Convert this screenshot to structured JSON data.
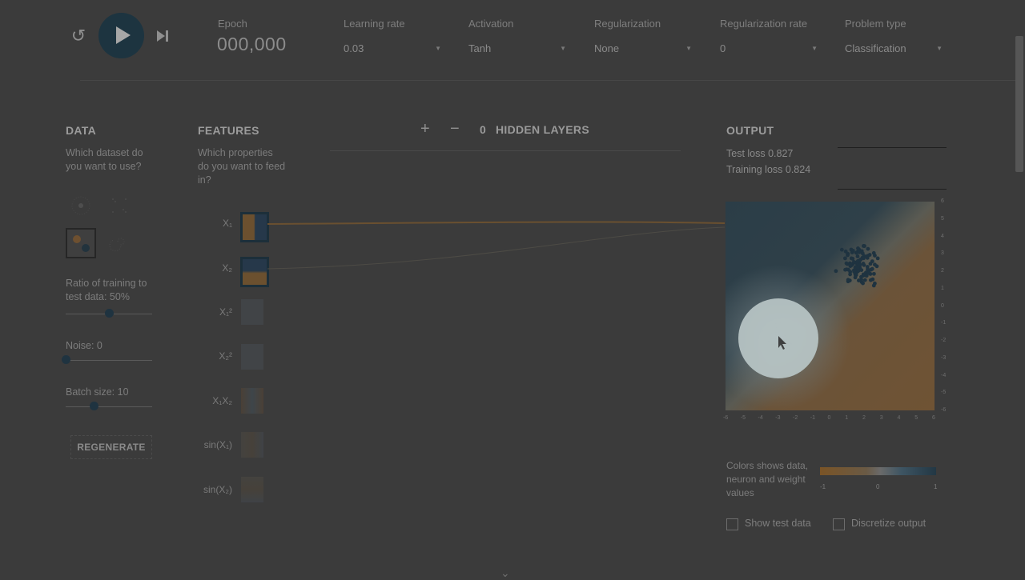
{
  "top_bar": {
    "epoch": {
      "label": "Epoch",
      "value": "000,000"
    },
    "learning_rate": {
      "label": "Learning rate",
      "value": "0.03"
    },
    "activation": {
      "label": "Activation",
      "value": "Tanh"
    },
    "regularization": {
      "label": "Regularization",
      "value": "None"
    },
    "regularization_rate": {
      "label": "Regularization rate",
      "value": "0"
    },
    "problem_type": {
      "label": "Problem type",
      "value": "Classification"
    }
  },
  "data": {
    "title": "DATA",
    "question": "Which dataset do you want to use?",
    "ratio_label": "Ratio of training to test data:",
    "ratio_value": "50%",
    "ratio_fraction": 0.5,
    "noise_label": "Noise:",
    "noise_value": "0",
    "noise_fraction": 0.0,
    "batch_label": "Batch size:",
    "batch_value": "10",
    "batch_fraction": 0.32,
    "regenerate": "REGENERATE"
  },
  "features": {
    "title": "FEATURES",
    "question": "Which properties do you want to feed in?",
    "items": [
      {
        "label": "X₁",
        "active": true
      },
      {
        "label": "X₂",
        "active": true
      },
      {
        "label": "X₁²",
        "active": false
      },
      {
        "label": "X₂²",
        "active": false
      },
      {
        "label": "X₁X₂",
        "active": false
      },
      {
        "label": "sin(X₁)",
        "active": false
      },
      {
        "label": "sin(X₂)",
        "active": false
      }
    ]
  },
  "network": {
    "plus": "+",
    "minus": "−",
    "hidden_count": "0",
    "hidden_label": "HIDDEN LAYERS"
  },
  "output": {
    "title": "OUTPUT",
    "test_loss": "Test loss 0.827",
    "training_loss": "Training loss 0.824",
    "legend_text": "Colors shows data, neuron and weight values",
    "legend_ticks": [
      "-1",
      "0",
      "1"
    ],
    "x_ticks": [
      "-6",
      "-5",
      "-4",
      "-3",
      "-2",
      "-1",
      "0",
      "1",
      "2",
      "3",
      "4",
      "5",
      "6"
    ],
    "y_ticks": [
      "6",
      "5",
      "4",
      "3",
      "2",
      "1",
      "0",
      "-1",
      "-2",
      "-3",
      "-4",
      "-5",
      "-6"
    ],
    "show_test_data": "Show test data",
    "discretize_output": "Discretize output"
  },
  "colors": {
    "negative": "#7a5426",
    "positive": "#223744",
    "background": "#3b3b3b"
  }
}
